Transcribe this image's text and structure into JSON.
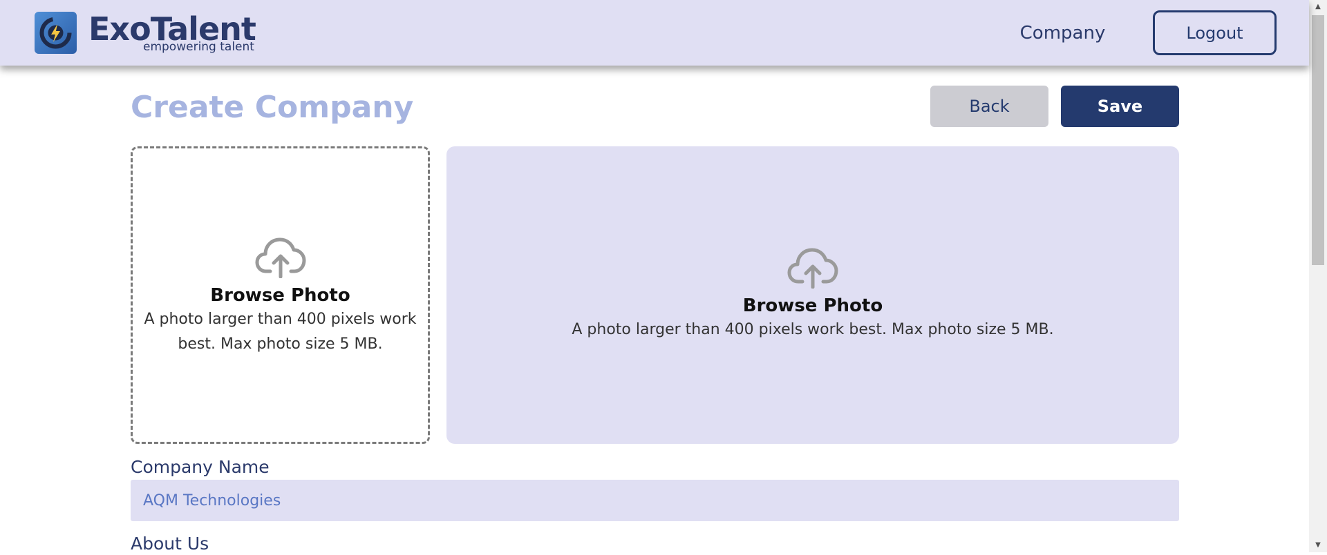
{
  "header": {
    "logo_name": "ExoTalent",
    "logo_tagline": "empowering talent",
    "nav_company": "Company",
    "logout_label": "Logout"
  },
  "page": {
    "title": "Create Company",
    "back_label": "Back",
    "save_label": "Save"
  },
  "photo_upload": {
    "square": {
      "title": "Browse Photo",
      "description": "A photo larger than 400 pixels work best. Max photo size 5 MB.",
      "icon": "cloud-upload-icon"
    },
    "banner": {
      "title": "Browse Photo",
      "description": "A photo larger than 400 pixels work best. Max photo size 5 MB.",
      "icon": "cloud-upload-icon"
    }
  },
  "form": {
    "company_name_label": "Company Name",
    "company_name_value": "AQM Technologies",
    "about_us_label": "About Us"
  },
  "colors": {
    "header_bg": "#e0dff3",
    "brand_navy": "#243a6e",
    "title_color": "#a6b4e0",
    "back_btn_bg": "#ccccd2",
    "input_bg": "#e0dff3"
  }
}
